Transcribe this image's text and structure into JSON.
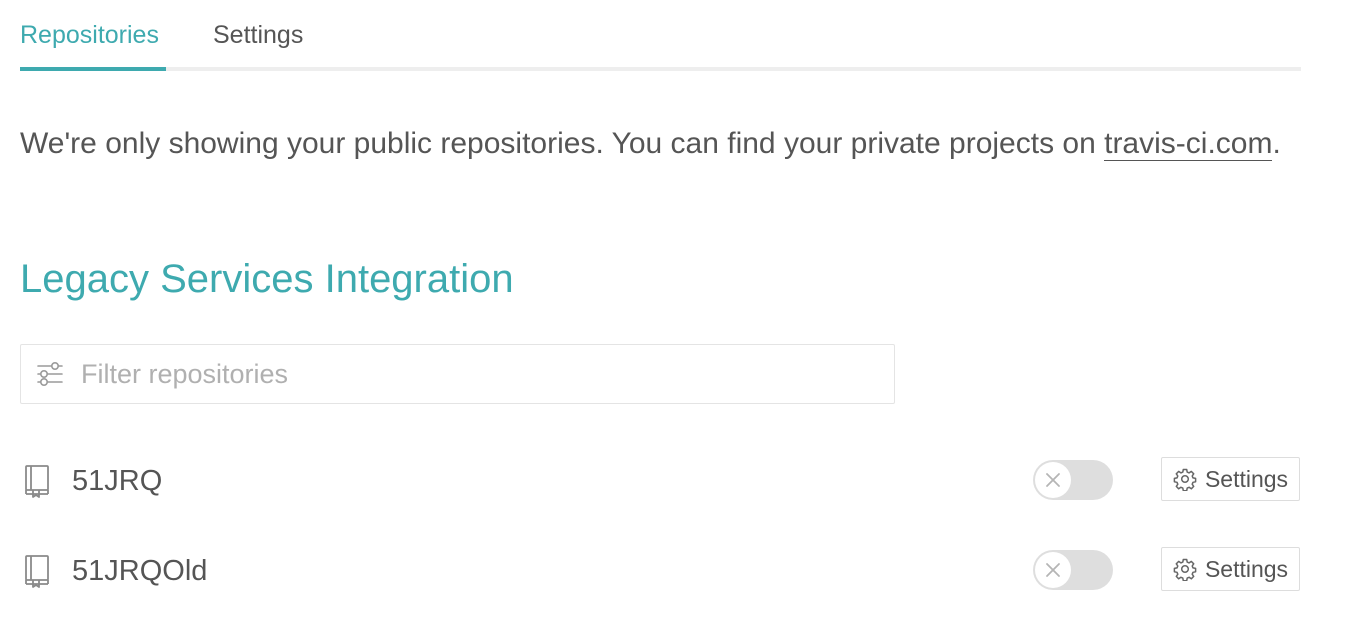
{
  "tabs": [
    {
      "label": "Repositories",
      "active": true
    },
    {
      "label": "Settings",
      "active": false
    }
  ],
  "notice": {
    "text": "We're only showing your public repositories. You can find your private projects on ",
    "link_text": "travis-ci.com",
    "suffix": "."
  },
  "section": {
    "title": "Legacy Services Integration"
  },
  "filter": {
    "placeholder": "Filter repositories",
    "value": "",
    "icon": "filter-sliders-icon"
  },
  "repositories": [
    {
      "name": "51JRQ",
      "enabled": false,
      "settings_label": "Settings"
    },
    {
      "name": "51JRQOld",
      "enabled": false,
      "settings_label": "Settings"
    }
  ],
  "colors": {
    "accent": "#3eaaaf",
    "text": "#555555",
    "toggle_off": "#dedede",
    "border": "#e4e4e4"
  }
}
